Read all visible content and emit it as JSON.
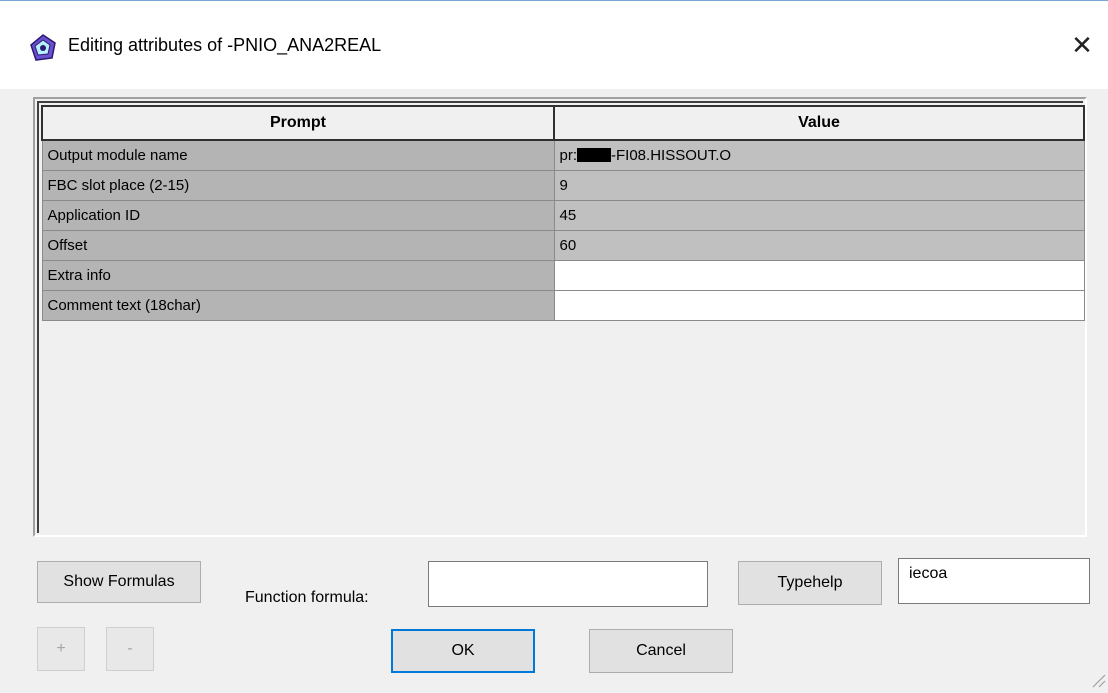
{
  "window": {
    "title": "Editing attributes of -PNIO_ANA2REAL",
    "title_icon": "editing-attributes-icon",
    "close_glyph": "✕"
  },
  "table": {
    "headers": {
      "prompt": "Prompt",
      "value": "Value"
    },
    "rows": [
      {
        "prompt": "Output module name",
        "value_prefix": "pr:",
        "value_suffix": "-FI08.HISSOUT.O",
        "redacted": true,
        "editable": false
      },
      {
        "prompt": "FBC slot place (2-15)",
        "value": "9",
        "editable": false
      },
      {
        "prompt": "Application ID",
        "value": "45",
        "editable": false
      },
      {
        "prompt": "Offset",
        "value": "60",
        "editable": false
      },
      {
        "prompt": "Extra info",
        "value": "",
        "editable": true
      },
      {
        "prompt": "Comment text (18char)",
        "value": "",
        "editable": true
      }
    ]
  },
  "controls": {
    "show_formulas": "Show Formulas",
    "function_formula_label": "Function formula:",
    "function_formula_value": "",
    "typehelp": "Typehelp",
    "type_value": "iecoa",
    "plus": "+",
    "minus": "-",
    "ok": "OK",
    "cancel": "Cancel"
  },
  "colors": {
    "accent": "#0078d7",
    "row_gray": "#c0c0c0",
    "prompt_gray": "#b4b4b4"
  }
}
